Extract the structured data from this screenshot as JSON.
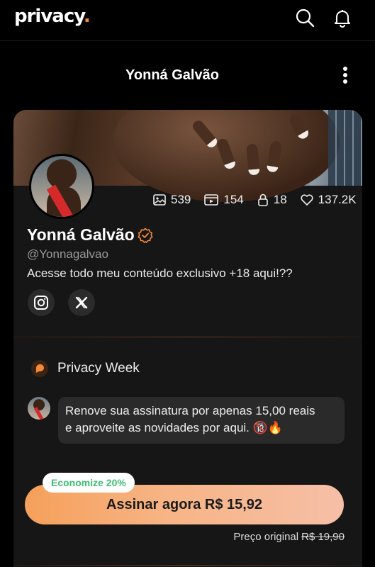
{
  "topbar": {
    "logo_text": "privacy",
    "logo_dot": ".",
    "icons": [
      "search-icon",
      "bell-icon"
    ]
  },
  "header": {
    "title": "Yonná Galvão",
    "menu_icon": "kebab-menu-icon"
  },
  "profile": {
    "stats": {
      "photos": "539",
      "videos": "154",
      "locked": "18",
      "likes": "137.2K"
    },
    "name": "Yonná Galvão",
    "handle": "@Yonnagalvao",
    "bio": "Acesse todo meu conteúdo exclusivo +18 aqui!??",
    "social": [
      "instagram-icon",
      "x-icon"
    ]
  },
  "promo": {
    "title": "Privacy Week",
    "message_line1": "Renove sua assinatura por apenas 15,00 reais",
    "message_line2": "e aproveite as novidades por aqui. 🔞🔥",
    "badge": "Economize 20%",
    "button_label": "Assinar agora R$ 15,92",
    "original_label": "Preço original",
    "original_price": "R$ 19,90"
  },
  "colors": {
    "accent": "#f58a3a",
    "badge_text": "#3dbd73",
    "background": "#000000",
    "card": "#161616"
  }
}
